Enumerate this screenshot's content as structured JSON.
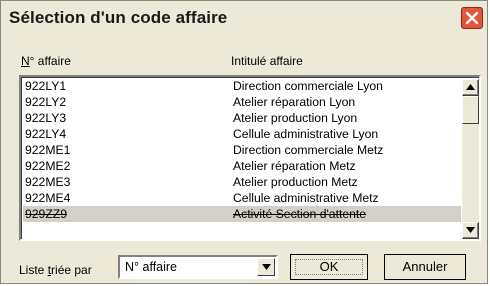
{
  "window": {
    "title": "Sélection d'un code affaire"
  },
  "columns": {
    "code": "N° affaire",
    "code_accel": "N",
    "code_rest": "° affaire",
    "label": "Intitulé affaire"
  },
  "rows": [
    {
      "code": "922LY1",
      "label": "Direction commerciale Lyon"
    },
    {
      "code": "922LY2",
      "label": "Atelier réparation Lyon"
    },
    {
      "code": "922LY3",
      "label": "Atelier production Lyon"
    },
    {
      "code": "922LY4",
      "label": "Cellule administrative Lyon"
    },
    {
      "code": "922ME1",
      "label": "Direction commerciale Metz"
    },
    {
      "code": "922ME2",
      "label": "Atelier réparation Metz"
    },
    {
      "code": "922ME3",
      "label": "Atelier production Metz"
    },
    {
      "code": "922ME4",
      "label": "Cellule administrative Metz"
    },
    {
      "code": "929ZZ9",
      "label": "Activité Section d'attente"
    }
  ],
  "sort": {
    "label_before": "Liste ",
    "label_accel": "t",
    "label_after": "riée par",
    "selected": "N° affaire"
  },
  "buttons": {
    "ok": "OK",
    "cancel": "Annuler"
  },
  "icons": {
    "close": "close-icon",
    "scroll_up": "arrow-up-icon",
    "scroll_down": "arrow-down-icon",
    "dropdown": "chevron-down-icon"
  },
  "colors": {
    "close_button": "#e2553a",
    "window_bg": "#ece9d8"
  }
}
